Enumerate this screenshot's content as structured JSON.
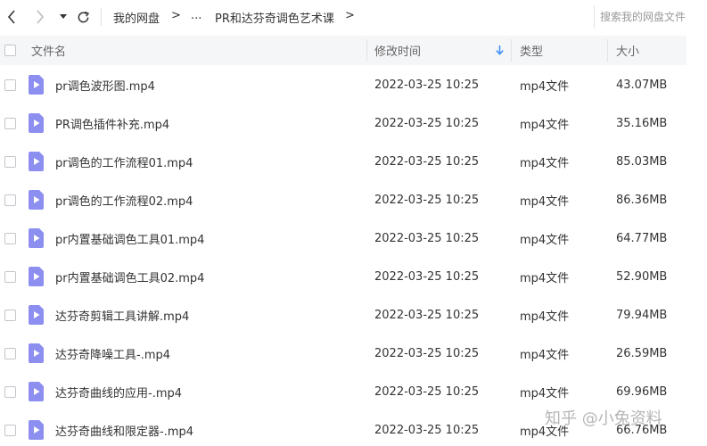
{
  "toolbar": {
    "breadcrumb": [
      "我的网盘",
      "...",
      "PR和达芬奇调色艺术课"
    ],
    "separator": ">",
    "search_placeholder": "搜索我的网盘文件"
  },
  "header": {
    "name": "文件名",
    "modified": "修改时间",
    "type": "类型",
    "size": "大小"
  },
  "files": [
    {
      "name": "pr调色波形图.mp4",
      "time": "2022-03-25 10:25",
      "type": "mp4文件",
      "size": "43.07MB"
    },
    {
      "name": "PR调色插件补充.mp4",
      "time": "2022-03-25 10:25",
      "type": "mp4文件",
      "size": "35.16MB"
    },
    {
      "name": "pr调色的工作流程01.mp4",
      "time": "2022-03-25 10:25",
      "type": "mp4文件",
      "size": "85.03MB"
    },
    {
      "name": "pr调色的工作流程02.mp4",
      "time": "2022-03-25 10:25",
      "type": "mp4文件",
      "size": "86.36MB"
    },
    {
      "name": "pr内置基础调色工具01.mp4",
      "time": "2022-03-25 10:25",
      "type": "mp4文件",
      "size": "64.77MB"
    },
    {
      "name": "pr内置基础调色工具02.mp4",
      "time": "2022-03-25 10:25",
      "type": "mp4文件",
      "size": "52.90MB"
    },
    {
      "name": "达芬奇剪辑工具讲解.mp4",
      "time": "2022-03-25 10:25",
      "type": "mp4文件",
      "size": "79.94MB"
    },
    {
      "name": "达芬奇降噪工具-.mp4",
      "time": "2022-03-25 10:25",
      "type": "mp4文件",
      "size": "26.59MB"
    },
    {
      "name": "达芬奇曲线的应用-.mp4",
      "time": "2022-03-25 10:25",
      "type": "mp4文件",
      "size": "69.96MB"
    },
    {
      "name": "达芬奇曲线和限定器-.mp4",
      "time": "2022-03-25 10:25",
      "type": "mp4文件",
      "size": "66.76MB"
    }
  ],
  "watermark": "知乎 @小兔资料",
  "colors": {
    "video_icon": "#8c8ef0",
    "sort_arrow": "#3b8cff",
    "header_bg": "#f5f6f8"
  }
}
